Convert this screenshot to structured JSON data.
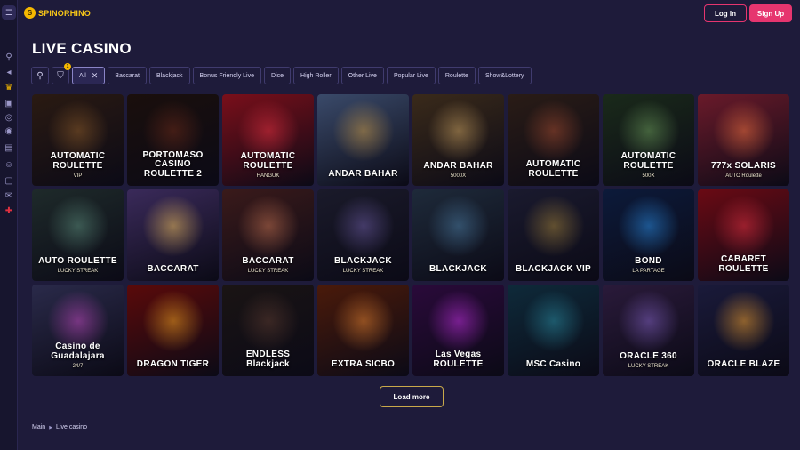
{
  "header": {
    "logo_text": "SPINORHINO",
    "login_label": "Log In",
    "signup_label": "Sign Up"
  },
  "rail": {
    "icons": [
      "menu-icon",
      "search-icon",
      "megaphone-icon",
      "crown-icon",
      "slots-icon",
      "poker-chip-icon",
      "live-icon",
      "cards-icon",
      "support-icon",
      "lock-icon",
      "chat-icon",
      "flag-uk-icon"
    ]
  },
  "page": {
    "title": "LIVE CASINO"
  },
  "filters": {
    "filter_badge": "1",
    "chips": [
      {
        "label": "All"
      },
      {
        "label": "Baccarat"
      },
      {
        "label": "Blackjack"
      },
      {
        "label": "Bonus Friendly Live"
      },
      {
        "label": "Dice"
      },
      {
        "label": "High Roller"
      },
      {
        "label": "Other Live"
      },
      {
        "label": "Popular Live"
      },
      {
        "label": "Roulette"
      },
      {
        "label": "Show&Lottery"
      }
    ]
  },
  "games": [
    {
      "title": "AUTOMATIC ROULETTE",
      "sub": "VIP",
      "bg": "#2a1a12",
      "glow": "#8a5a2a"
    },
    {
      "title": "PORTOMASO CASINO ROULETTE 2",
      "sub": "",
      "bg": "#1a0f0c",
      "glow": "#6a2a1a"
    },
    {
      "title": "AUTOMATIC ROULETTE",
      "sub": "HANGUK",
      "bg": "#7a0f1a",
      "glow": "#e23040"
    },
    {
      "title": "ANDAR BAHAR",
      "sub": "",
      "bg": "#3a4a6a",
      "glow": "#c89a4a"
    },
    {
      "title": "ANDAR BAHAR",
      "sub": "5000X",
      "bg": "#3a2a1a",
      "glow": "#c8a060"
    },
    {
      "title": "AUTOMATIC ROULETTE",
      "sub": "",
      "bg": "#2a1c16",
      "glow": "#a04a30"
    },
    {
      "title": "AUTOMATIC ROULETTE",
      "sub": "500X",
      "bg": "#1a2a1a",
      "glow": "#6a9a5a"
    },
    {
      "title": "777x SOLARIS",
      "sub": "AUTO Roulette",
      "bg": "#6a1a2a",
      "glow": "#f07040"
    },
    {
      "title": "AUTO ROULETTE",
      "sub": "LUCKY STREAK",
      "bg": "#1e2a2a",
      "glow": "#5a8a7a"
    },
    {
      "title": "BACCARAT",
      "sub": "",
      "bg": "#3a2a5a",
      "glow": "#f0c060"
    },
    {
      "title": "BACCARAT",
      "sub": "LUCKY STREAK",
      "bg": "#3a1a1a",
      "glow": "#c07050"
    },
    {
      "title": "BLACKJACK",
      "sub": "LUCKY STREAK",
      "bg": "#1a1a2a",
      "glow": "#6a5aa0"
    },
    {
      "title": "BLACKJACK",
      "sub": "",
      "bg": "#1e2a3a",
      "glow": "#4a7aa0"
    },
    {
      "title": "BLACKJACK VIP",
      "sub": "",
      "bg": "#1a1a2e",
      "glow": "#a0803a"
    },
    {
      "title": "BOND",
      "sub": "LA PARTAGE",
      "bg": "#0c1a3a",
      "glow": "#2a8ae0"
    },
    {
      "title": "CABARET ROULETTE",
      "sub": "",
      "bg": "#6a0a14",
      "glow": "#e03040"
    },
    {
      "title": "Casino de Guadalajara",
      "sub": "24/7",
      "bg": "#2a2a4a",
      "glow": "#c04ac0"
    },
    {
      "title": "DRAGON TIGER",
      "sub": "",
      "bg": "#5a0a0a",
      "glow": "#f0a020"
    },
    {
      "title": "ENDLESS Blackjack",
      "sub": "",
      "bg": "#1a1414",
      "glow": "#5a3a30"
    },
    {
      "title": "EXTRA SICBO",
      "sub": "",
      "bg": "#4a1a0a",
      "glow": "#e08030"
    },
    {
      "title": "Las Vegas ROULETTE",
      "sub": "",
      "bg": "#2a0a3a",
      "glow": "#c030e0"
    },
    {
      "title": "MSC Casino",
      "sub": "",
      "bg": "#0e2a3a",
      "glow": "#2a8aa0"
    },
    {
      "title": "ORACLE 360",
      "sub": "LUCKY STREAK",
      "bg": "#2a1a3a",
      "glow": "#8060c0"
    },
    {
      "title": "ORACLE BLAZE",
      "sub": "",
      "bg": "#1a1a3a",
      "glow": "#f0a030"
    }
  ],
  "load_more_label": "Load more",
  "breadcrumb": {
    "home": "Main",
    "current": "Live casino"
  },
  "colors": {
    "accent": "#e6356f",
    "brand": "#f5b800",
    "background": "#1e1b3a",
    "load_more_border": "#c9a94a"
  }
}
